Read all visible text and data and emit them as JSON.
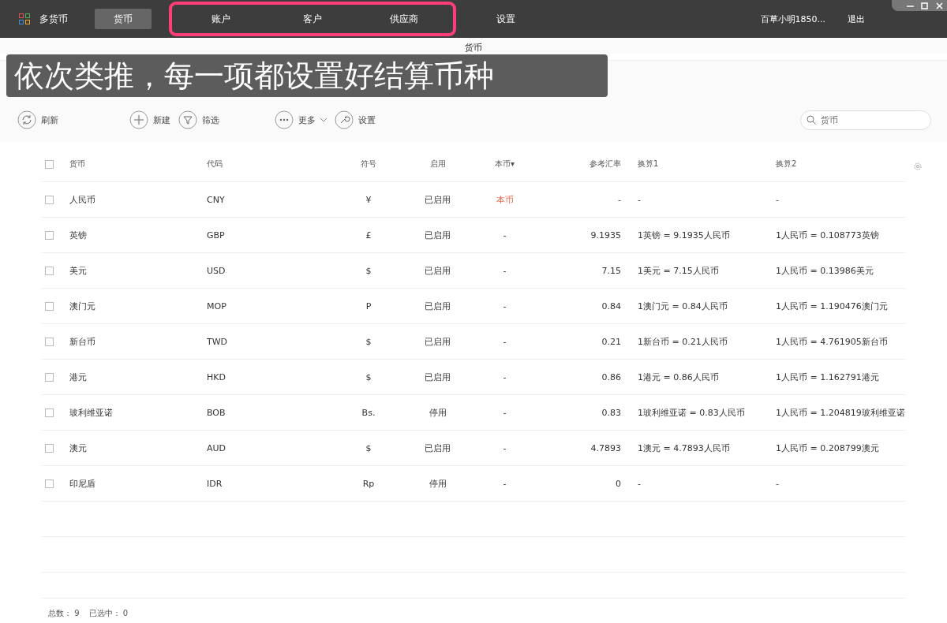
{
  "app": {
    "title": "多货币"
  },
  "nav": [
    {
      "kind": "tab",
      "label": "货币",
      "selected": true
    },
    {
      "kind": "highlight-frame",
      "items": [
        {
          "label": "账户",
          "selected": false
        },
        {
          "label": "客户",
          "selected": false
        },
        {
          "label": "供应商",
          "selected": false
        }
      ]
    },
    {
      "kind": "tab",
      "label": "设置",
      "selected": false
    }
  ],
  "user": "百草小明1850...",
  "logout": "退出",
  "page_title": "货币",
  "caption": "依次类推，每一项都设置好结算币种",
  "toolbar": [
    {
      "label": "刷新"
    },
    {
      "label": "新建"
    },
    {
      "label": "筛选"
    },
    {
      "label": "更多",
      "dropdown": true
    },
    {
      "label": "设置"
    }
  ],
  "search": {
    "placeholder": "货币"
  },
  "table": {
    "all_checked": false,
    "columns": [
      "货币",
      "代码",
      "符号",
      "启用",
      "本币▾",
      "参考汇率",
      "换算1",
      "换算2"
    ],
    "rows": [
      {
        "checked": false,
        "cells": [
          "人民币",
          "CNY",
          "¥",
          "已启用",
          "本币",
          "-",
          "-",
          "-"
        ],
        "base": true
      },
      {
        "checked": false,
        "cells": [
          "英镑",
          "GBP",
          "£",
          "已启用",
          "-",
          "9.1935",
          "1英镑 = 9.1935人民币",
          "1人民币 = 0.108773英镑"
        ],
        "base": false
      },
      {
        "checked": false,
        "cells": [
          "美元",
          "USD",
          "$",
          "已启用",
          "-",
          "7.15",
          "1美元 = 7.15人民币",
          "1人民币 = 0.13986美元"
        ],
        "base": false
      },
      {
        "checked": false,
        "cells": [
          "澳门元",
          "MOP",
          "P",
          "已启用",
          "-",
          "0.84",
          "1澳门元 = 0.84人民币",
          "1人民币 = 1.190476澳门元"
        ],
        "base": false
      },
      {
        "checked": false,
        "cells": [
          "新台币",
          "TWD",
          "$",
          "已启用",
          "-",
          "0.21",
          "1新台币 = 0.21人民币",
          "1人民币 = 4.761905新台币"
        ],
        "base": false
      },
      {
        "checked": false,
        "cells": [
          "港元",
          "HKD",
          "$",
          "已启用",
          "-",
          "0.86",
          "1港元 = 0.86人民币",
          "1人民币 = 1.162791港元"
        ],
        "base": false
      },
      {
        "checked": false,
        "cells": [
          "玻利维亚诺",
          "BOB",
          "Bs.",
          "停用",
          "-",
          "0.83",
          "1玻利维亚诺 = 0.83人民币",
          "1人民币 = 1.204819玻利维亚诺"
        ],
        "base": false
      },
      {
        "checked": false,
        "cells": [
          "澳元",
          "AUD",
          "$",
          "已启用",
          "-",
          "4.7893",
          "1澳元 = 4.7893人民币",
          "1人民币 = 0.208799澳元"
        ],
        "base": false
      },
      {
        "checked": false,
        "cells": [
          "印尼盾",
          "IDR",
          "Rp",
          "停用",
          "-",
          "0",
          "-",
          "-"
        ],
        "base": false
      }
    ]
  },
  "footer": {
    "total_label": "总数：",
    "total": "9",
    "selected_label": "已选中：",
    "selected": "0"
  }
}
